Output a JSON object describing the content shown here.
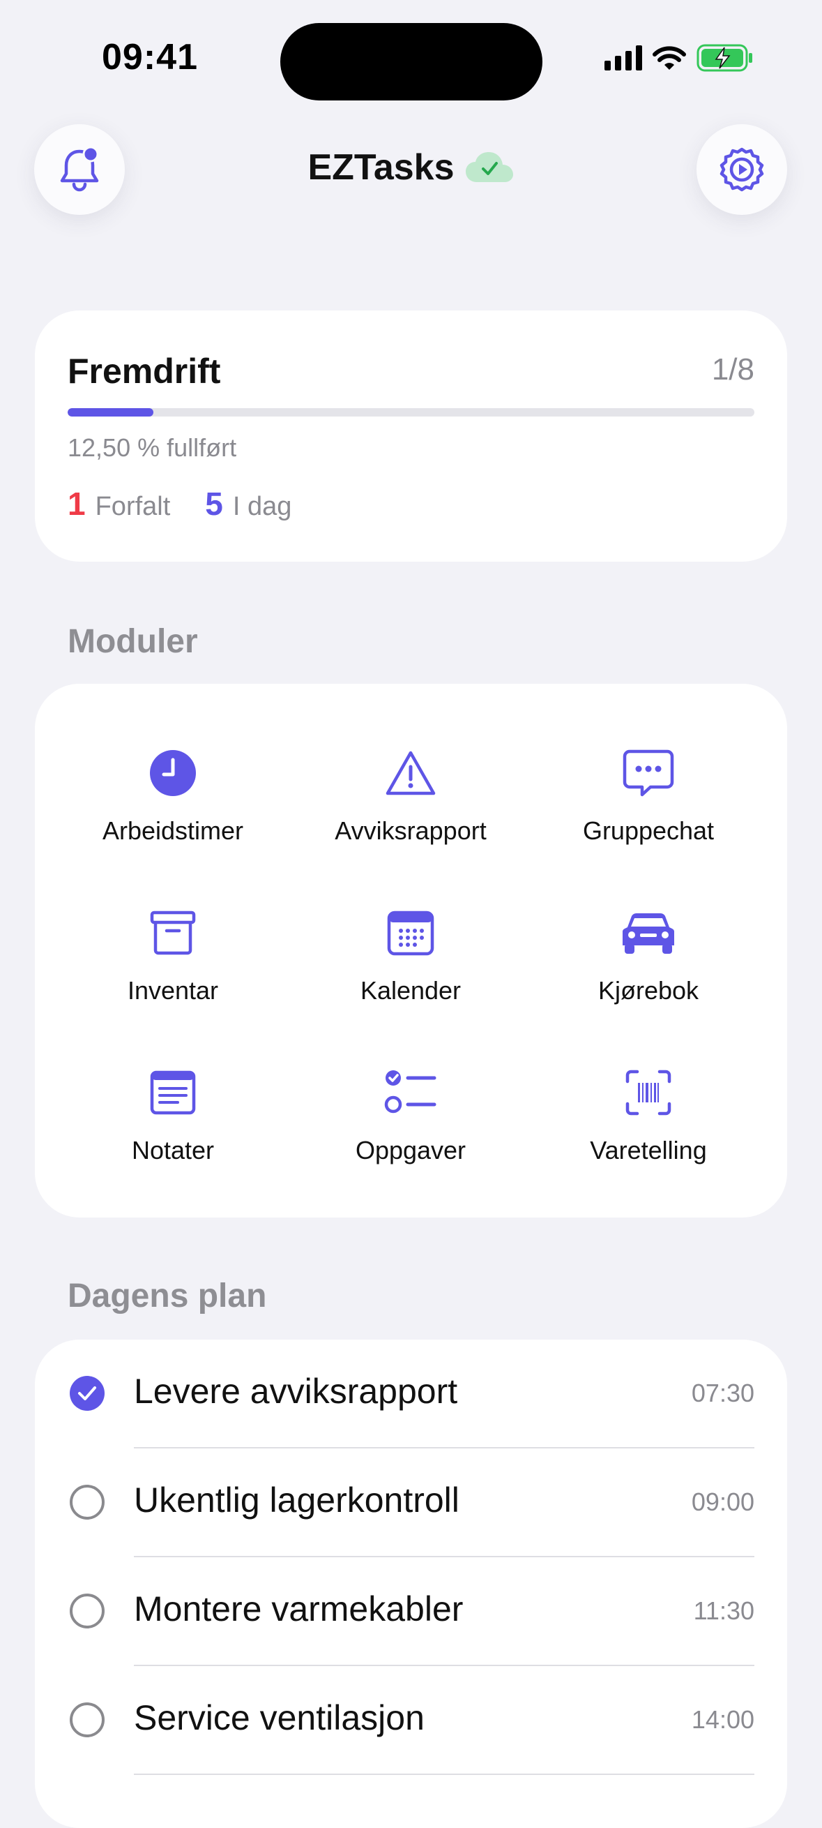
{
  "status_bar": {
    "time": "09:41"
  },
  "header": {
    "title": "EZTasks",
    "sync_status": "synced"
  },
  "progress": {
    "title": "Fremdrift",
    "count": "1/8",
    "fraction": 0.125,
    "percent_text": "12,50 % fullført",
    "overdue_count": "1",
    "overdue_label": "Forfalt",
    "today_count": "5",
    "today_label": "I dag"
  },
  "modules": {
    "section_title": "Moduler",
    "items": [
      {
        "label": "Arbeidstimer",
        "icon": "clock-icon"
      },
      {
        "label": "Avviksrapport",
        "icon": "warning-icon"
      },
      {
        "label": "Gruppechat",
        "icon": "chat-icon"
      },
      {
        "label": "Inventar",
        "icon": "archive-box-icon"
      },
      {
        "label": "Kalender",
        "icon": "calendar-icon"
      },
      {
        "label": "Kjørebok",
        "icon": "car-icon"
      },
      {
        "label": "Notater",
        "icon": "notes-icon"
      },
      {
        "label": "Oppgaver",
        "icon": "checklist-icon"
      },
      {
        "label": "Varetelling",
        "icon": "barcode-scan-icon"
      }
    ]
  },
  "plan": {
    "section_title": "Dagens plan",
    "items": [
      {
        "title": "Levere avviksrapport",
        "time": "07:30",
        "done": true
      },
      {
        "title": "Ukentlig lagerkontroll",
        "time": "09:00",
        "done": false
      },
      {
        "title": "Montere varmekabler",
        "time": "11:30",
        "done": false
      },
      {
        "title": "Service ventilasjon",
        "time": "14:00",
        "done": false
      }
    ]
  },
  "colors": {
    "accent": "#5e55e6",
    "overdue": "#ef3b47",
    "background": "#f2f2f7",
    "sync_green": "#34c759"
  }
}
